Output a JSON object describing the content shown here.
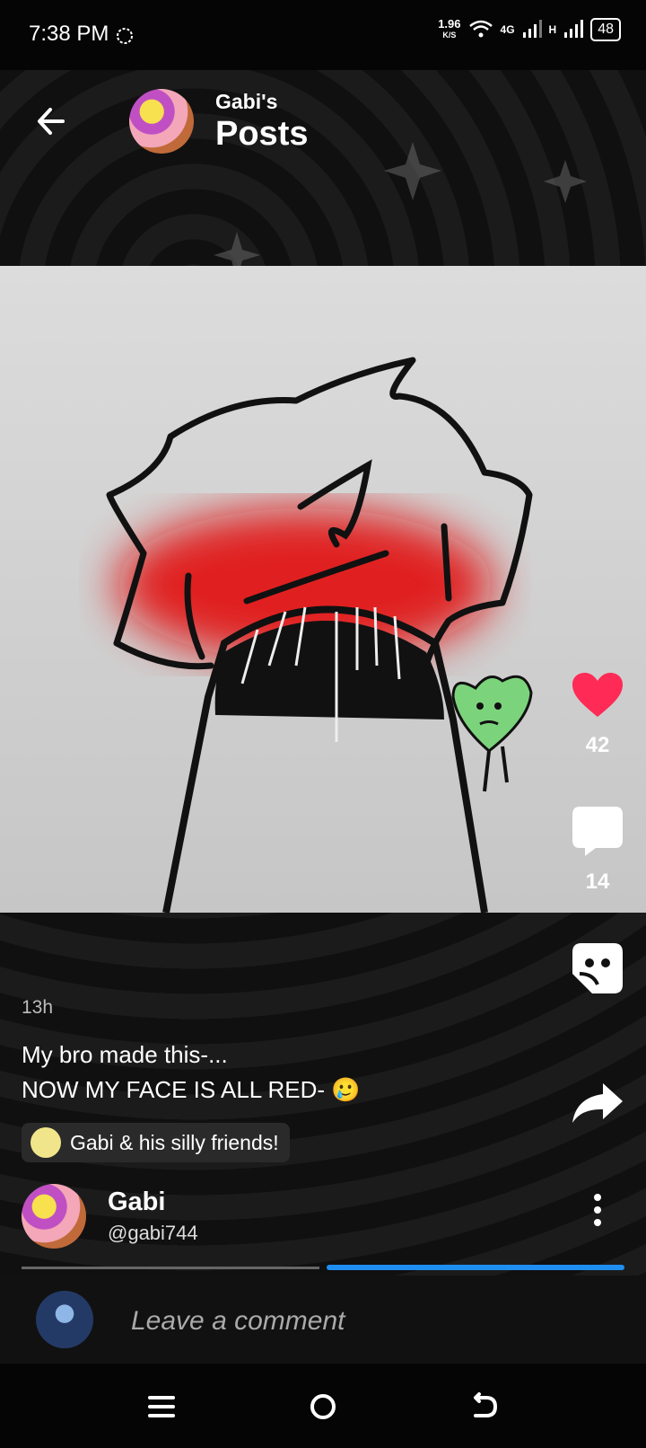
{
  "status": {
    "time": "7:38 PM",
    "speed_value": "1.96",
    "speed_unit": "K/S",
    "network": "4G",
    "network2": "H",
    "battery": "48"
  },
  "header": {
    "subtitle": "Gabi's",
    "title": "Posts"
  },
  "actions": {
    "likes": "42",
    "comments": "14"
  },
  "post": {
    "timestamp": "13h",
    "caption_line1": "My bro made this-...",
    "caption_line2": "NOW MY FACE IS ALL RED-",
    "emoji": "🥲",
    "community": "Gabi & his silly friends!"
  },
  "author": {
    "name": "Gabi",
    "handle": "@gabi744"
  },
  "comment": {
    "placeholder": "Leave a comment"
  },
  "colors": {
    "heart": "#ff2a55",
    "progress": "#1f8ef1"
  }
}
